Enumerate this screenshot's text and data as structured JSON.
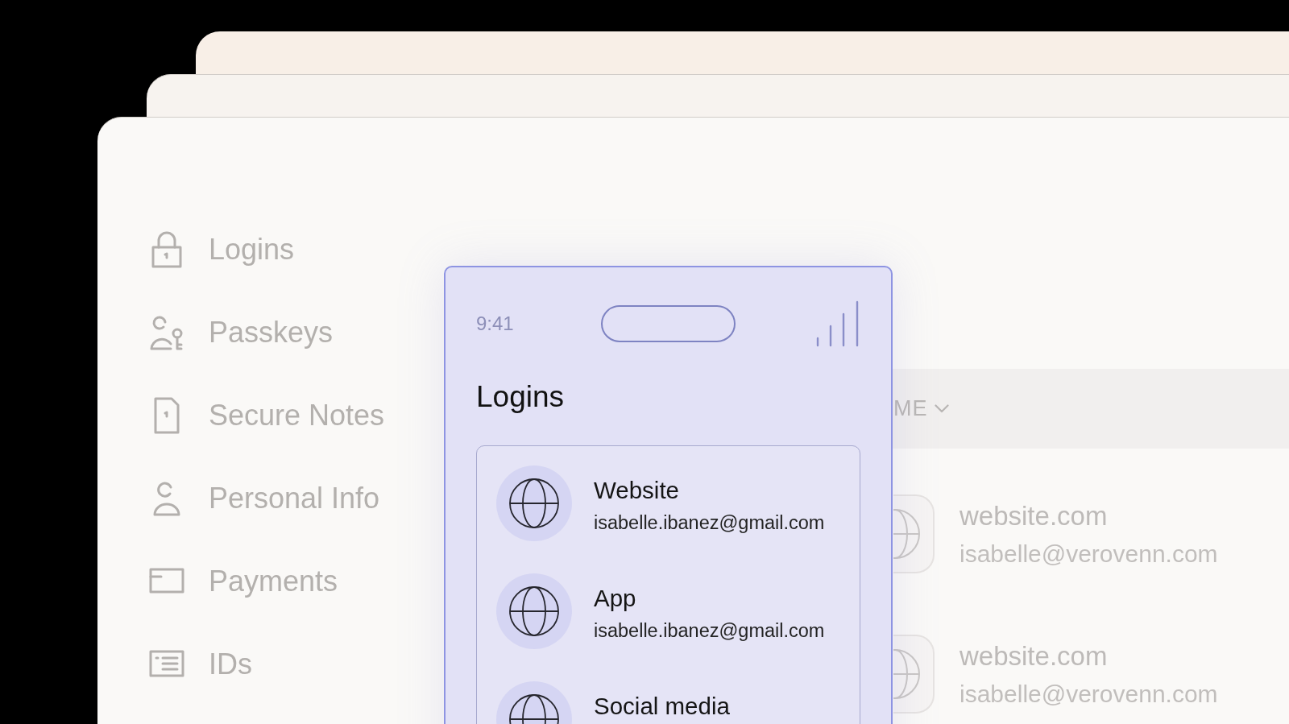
{
  "sidebar": {
    "items": [
      {
        "label": "Logins"
      },
      {
        "label": "Passkeys"
      },
      {
        "label": "Secure Notes"
      },
      {
        "label": "Personal Info"
      },
      {
        "label": "Payments"
      },
      {
        "label": "IDs"
      }
    ]
  },
  "list": {
    "header": "ME",
    "rows": [
      {
        "title": "website.com",
        "email": "isabelle@verovenn.com"
      },
      {
        "title": "website.com",
        "email": "isabelle@verovenn.com"
      }
    ]
  },
  "phone": {
    "time": "9:41",
    "title": "Logins",
    "items": [
      {
        "title": "Website",
        "email": "isabelle.ibanez@gmail.com"
      },
      {
        "title": "App",
        "email": "isabelle.ibanez@gmail.com"
      },
      {
        "title": "Social media"
      }
    ]
  }
}
